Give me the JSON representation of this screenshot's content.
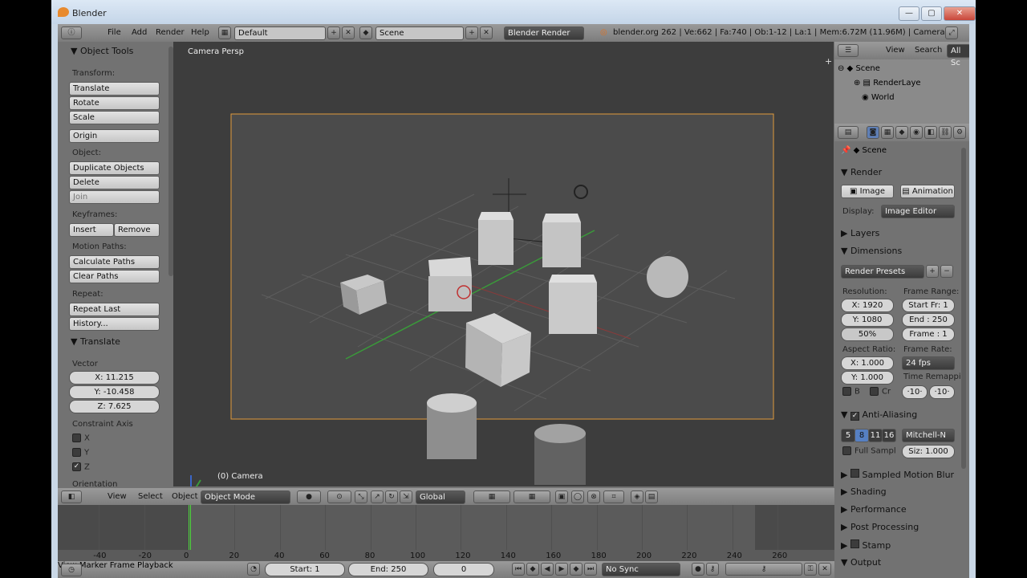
{
  "window": {
    "title": "Blender",
    "btn_min": "—",
    "btn_max": "▢",
    "btn_close": "✕"
  },
  "info_header": {
    "menus": [
      "File",
      "Add",
      "Render",
      "Help"
    ],
    "layout": "Default",
    "scene": "Scene",
    "engine": "Blender Render",
    "stats": "blender.org 262 | Ve:662 | Fa:740 | Ob:1-12 | La:1 | Mem:6.72M (11.96M) | Camera"
  },
  "tool_shelf": {
    "title": "Object Tools",
    "transform_label": "Transform:",
    "translate": "Translate",
    "rotate": "Rotate",
    "scale": "Scale",
    "origin": "Origin",
    "object_label": "Object:",
    "duplicate": "Duplicate Objects",
    "delete": "Delete",
    "join": "Join",
    "keyframes_label": "Keyframes:",
    "insert": "Insert",
    "remove": "Remove",
    "motion_label": "Motion Paths:",
    "calc_paths": "Calculate Paths",
    "clear_paths": "Clear Paths",
    "repeat_label": "Repeat:",
    "repeat_last": "Repeat Last",
    "history": "History...",
    "op_title": "Translate",
    "vector_label": "Vector",
    "x": "X: 11.215",
    "y": "Y: -10.458",
    "z": "Z: 7.625",
    "constraint_label": "Constraint Axis",
    "cx": "X",
    "cy": "Y",
    "cz": "Z",
    "orientation": "Orientation"
  },
  "viewport": {
    "view_name": "Camera Persp",
    "object_name": "(0) Camera"
  },
  "view3d_header": {
    "view": "View",
    "select": "Select",
    "object": "Object",
    "mode": "Object Mode",
    "orientation": "Global"
  },
  "outliner": {
    "view": "View",
    "search": "Search",
    "filter": "All Sc",
    "scene": "Scene",
    "render_layers": "RenderLaye",
    "world": "World"
  },
  "properties": {
    "context": "Scene",
    "render": "Render",
    "image_btn": "Image",
    "animation_btn": "Animation",
    "display_label": "Display:",
    "display": "Image Editor",
    "layers": "Layers",
    "dimensions": "Dimensions",
    "presets": "Render Presets",
    "resolution_label": "Resolution:",
    "res_x": "X: 1920",
    "res_y": "Y: 1080",
    "res_pct": "50%",
    "frame_range_label": "Frame Range:",
    "start_fr": "Start Fr: 1",
    "end": "End : 250",
    "frame": "Frame : 1",
    "aspect_label": "Aspect Ratio:",
    "asp_x": "X: 1.000",
    "asp_y": "Y: 1.000",
    "frame_rate_label": "Frame Rate:",
    "fps": "24 fps",
    "time_remap": "Time Remappi",
    "tr_old": "·10·",
    "tr_new": "·10·",
    "border": "B",
    "crop": "Cr",
    "aa": "Anti-Aliasing",
    "aa_5": "5",
    "aa_8": "8",
    "aa_11": "11",
    "aa_16": "16",
    "aa_filter": "Mitchell-N",
    "full_sample": "Full Sampl",
    "filter_size": "Siz: 1.000",
    "motion_blur": "Sampled Motion Blur",
    "shading": "Shading",
    "performance": "Performance",
    "post": "Post Processing",
    "stamp": "Stamp",
    "output": "Output"
  },
  "timeline": {
    "ticks": [
      "-40",
      "-20",
      "0",
      "20",
      "40",
      "60",
      "80",
      "100",
      "120",
      "140",
      "160",
      "180",
      "200",
      "220",
      "240",
      "260"
    ],
    "view": "View",
    "marker": "Marker",
    "frame": "Frame",
    "playback": "Playback",
    "start": "Start: 1",
    "end": "End: 250",
    "current": "0",
    "sync": "No Sync"
  }
}
